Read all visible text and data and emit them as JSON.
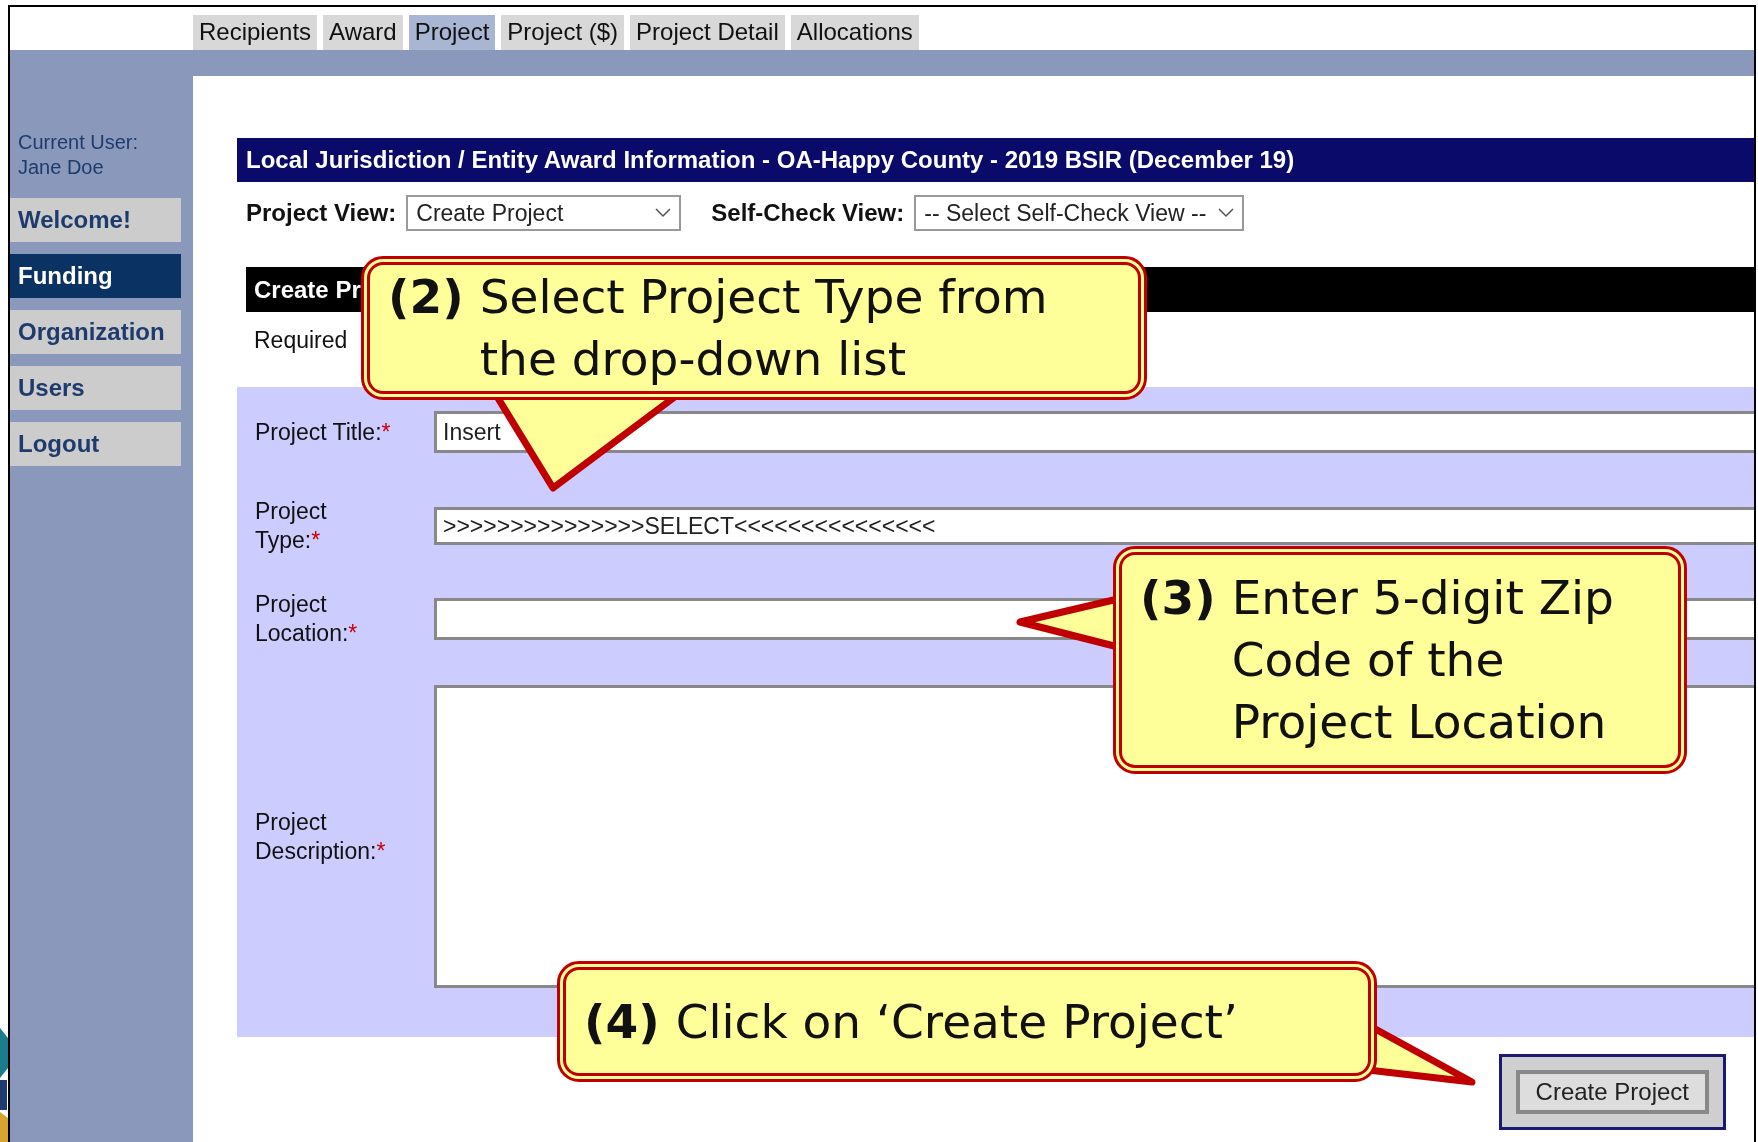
{
  "tabs": [
    {
      "label": "Recipients",
      "selected": false
    },
    {
      "label": "Award",
      "selected": false
    },
    {
      "label": "Project",
      "selected": true
    },
    {
      "label": "Project ($)",
      "selected": false
    },
    {
      "label": "Project Detail",
      "selected": false
    },
    {
      "label": "Allocations",
      "selected": false
    }
  ],
  "sidebar": {
    "user_label": "Current User:",
    "user_name": "Jane Doe",
    "items": [
      {
        "label": "Welcome!",
        "selected": false
      },
      {
        "label": "Funding",
        "selected": true
      },
      {
        "label": "Organization",
        "selected": false
      },
      {
        "label": "Users",
        "selected": false
      },
      {
        "label": "Logout",
        "selected": false
      }
    ]
  },
  "header": "Local Jurisdiction / Entity Award Information - OA-Happy County - 2019 BSIR (December 19)",
  "views": [
    {
      "label": "Project View:",
      "value": "Create Project"
    },
    {
      "label": "Self-Check View:",
      "value": "-- Select Self-Check View --"
    }
  ],
  "section_title": "Create Pr",
  "required_note": "Required",
  "form": [
    {
      "kind": "input",
      "label": "Project Title:",
      "required_mark": "*",
      "value": "Insert"
    },
    {
      "kind": "input",
      "label": "Project Type:",
      "required_mark": "*",
      "value": ">>>>>>>>>>>>>>>SELECT<<<<<<<<<<<<<<<"
    },
    {
      "kind": "input",
      "label": "Project Location:",
      "required_mark": "*"
    },
    {
      "kind": "textarea",
      "label": "Project Description:",
      "required_mark": "*"
    }
  ],
  "submit_button": "Create Project",
  "callouts": [
    {
      "number": "(2)",
      "lines": [
        "Select Project Type from",
        "the drop-down list"
      ]
    },
    {
      "number": "(3)",
      "lines": [
        "Enter 5-digit Zip",
        "Code of the",
        "Project Location"
      ]
    },
    {
      "number": "(4)",
      "lines": [
        "Click on ‘Create Project’"
      ]
    }
  ]
}
